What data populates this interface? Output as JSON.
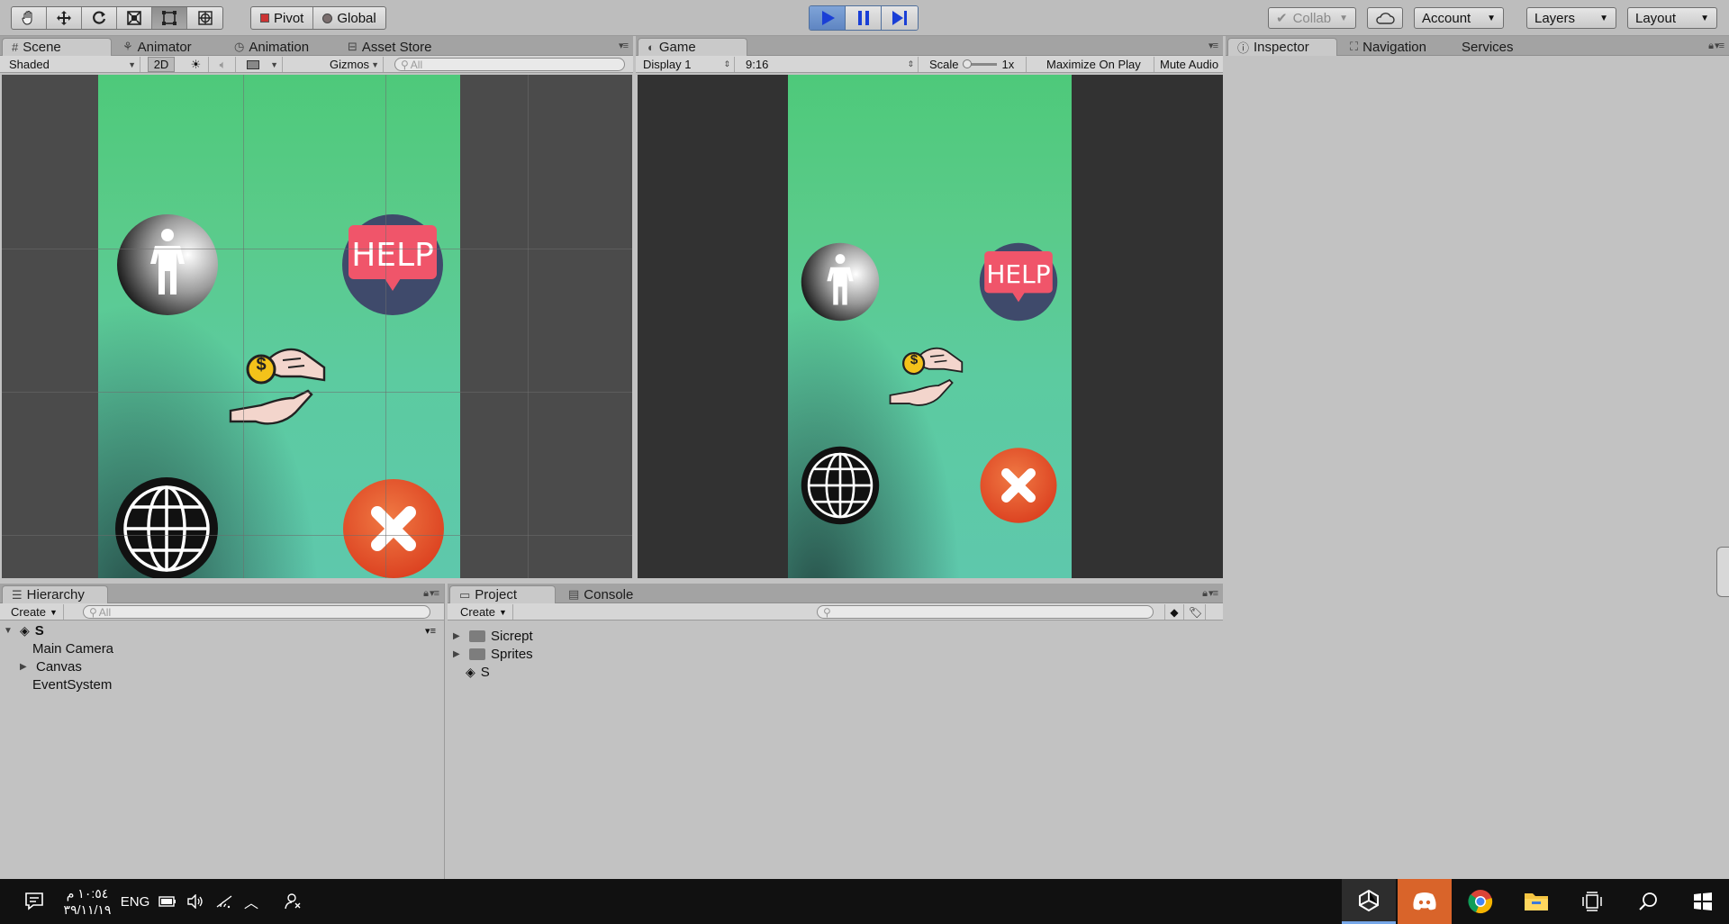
{
  "toolbar": {
    "pivot_label": "Pivot",
    "global_label": "Global",
    "collab_label": "Collab",
    "account_label": "Account",
    "layers_label": "Layers",
    "layout_label": "Layout"
  },
  "scene_panel": {
    "tabs": [
      "Scene",
      "Animator",
      "Animation",
      "Asset Store"
    ],
    "shading_mode": "Shaded",
    "mode_2d": "2D",
    "gizmos_label": "Gizmos",
    "search_placeholder": "All"
  },
  "game_panel": {
    "tab": "Game",
    "display": "Display 1",
    "aspect": "9:16",
    "scale_label": "Scale",
    "scale_value": "1x",
    "maximize_label": "Maximize On Play",
    "mute_label": "Mute Audio"
  },
  "inspector_panel": {
    "tabs": [
      "Inspector",
      "Navigation",
      "Services"
    ]
  },
  "hierarchy_panel": {
    "tab": "Hierarchy",
    "create_label": "Create",
    "search_placeholder": "All",
    "scene_name": "S",
    "items": [
      "Main Camera",
      "Canvas",
      "EventSystem"
    ]
  },
  "project_panel": {
    "tabs": [
      "Project",
      "Console"
    ],
    "create_label": "Create",
    "items": [
      "Sicrept",
      "Sprites",
      "S"
    ]
  },
  "game_ui": {
    "help_text": "HELP",
    "coin_symbol": "$"
  },
  "taskbar": {
    "time": "١٠:٥٤ م",
    "date": "٣٩/١١/١٩",
    "language": "ENG"
  },
  "colors": {
    "play_active": "#5f85c2",
    "game_green": "#4ec97a",
    "game_teal": "#5ec8ac",
    "help_red": "#f0556a",
    "close_orange": "#e8512a",
    "circle_navy": "#3f4a6b"
  }
}
